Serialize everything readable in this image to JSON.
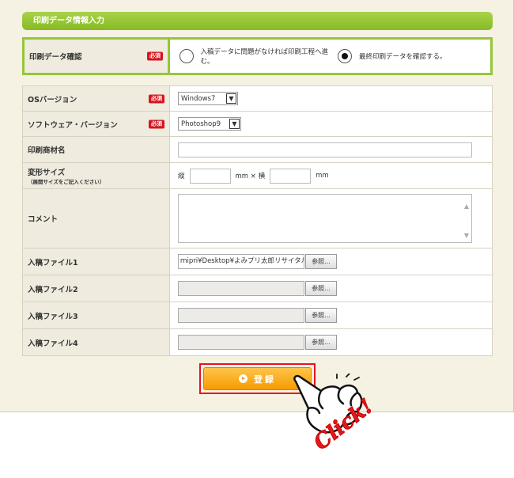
{
  "section": {
    "title": "印刷データ情報入力"
  },
  "required_label": "必須",
  "confirm": {
    "label": "印刷データ確認",
    "options": [
      {
        "label": "入稿データに問題がなければ印刷工程へ進む。",
        "checked": false
      },
      {
        "label": "最終印刷データを確認する。",
        "checked": true
      }
    ]
  },
  "fields": {
    "os": {
      "label": "OSバージョン",
      "value": "Windows7"
    },
    "software": {
      "label": "ソフトウェア・バージョン",
      "value": "Photoshop9"
    },
    "product": {
      "label": "印刷商材名",
      "value": ""
    },
    "size": {
      "label": "変形サイズ",
      "note": "（展開サイズをご記入ください）",
      "height_prefix": "縦",
      "mid_text": "mm × 横",
      "unit": "mm",
      "height_value": "",
      "width_value": ""
    },
    "comment": {
      "label": "コメント",
      "value": ""
    },
    "files": [
      {
        "label": "入稿ファイル1",
        "value": "ｍipri¥Desktop¥よみプリ太郎リサイタル.pdf"
      },
      {
        "label": "入稿ファイル2",
        "value": ""
      },
      {
        "label": "入稿ファイル3",
        "value": ""
      },
      {
        "label": "入稿ファイル4",
        "value": ""
      }
    ],
    "browse_label": "参照..."
  },
  "submit": {
    "label": "登録"
  },
  "annotation": {
    "text": "Click!"
  },
  "icons": {
    "submit": "play-circle-icon",
    "hand": "pointing-hand-icon",
    "select": "chevron-down-icon"
  },
  "colors": {
    "accent_green": "#95c63a",
    "required_red": "#d8141e",
    "submit_orange": "#f59c00",
    "highlight_red": "#e8121e"
  }
}
